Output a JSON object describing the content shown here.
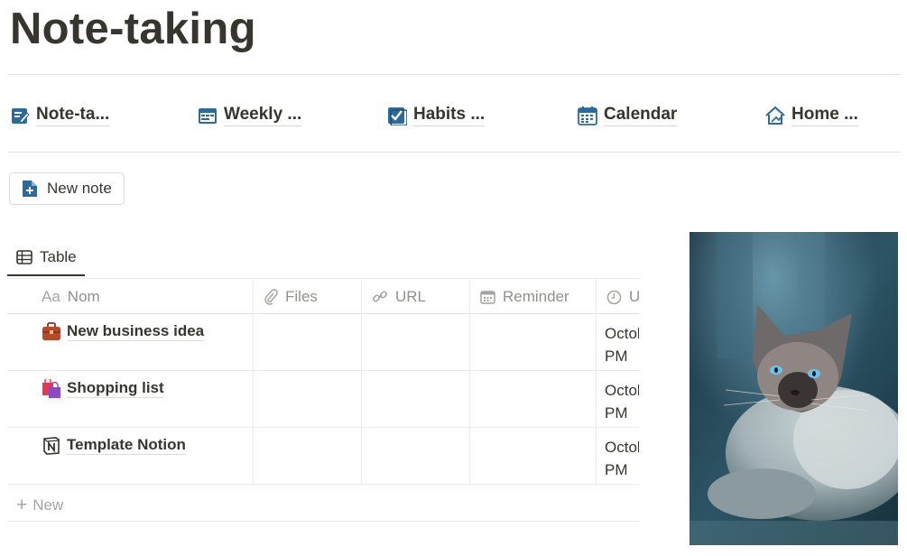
{
  "page": {
    "title": "Note-taking"
  },
  "links": [
    {
      "label": "Note-ta...",
      "icon": "note-icon"
    },
    {
      "label": "Weekly ...",
      "icon": "weekly-planner-icon"
    },
    {
      "label": "Habits ...",
      "icon": "checkbox-icon"
    },
    {
      "label": "Calendar",
      "icon": "calendar-icon"
    },
    {
      "label": "Home ...",
      "icon": "home-icon"
    }
  ],
  "actions": {
    "new_note": "New note"
  },
  "view": {
    "tab_label": "Table"
  },
  "table": {
    "columns": [
      {
        "icon_text": "Aa",
        "label": "Nom"
      },
      {
        "label": "Files"
      },
      {
        "label": "URL"
      },
      {
        "label": "Reminder"
      },
      {
        "label": "U"
      }
    ],
    "rows": [
      {
        "name": "New business idea",
        "icon": "briefcase-icon",
        "updated_1": "Octol",
        "updated_2": "PM"
      },
      {
        "name": "Shopping list",
        "icon": "shopping-bags-icon",
        "updated_1": "Octol",
        "updated_2": "PM"
      },
      {
        "name": "Template Notion",
        "icon": "notion-logo-icon",
        "updated_1": "Octol",
        "updated_2": "PM"
      }
    ],
    "new_row_label": "New"
  },
  "colors": {
    "accent": "#2b6a9c",
    "text": "#37352f",
    "muted": "#91918e"
  }
}
